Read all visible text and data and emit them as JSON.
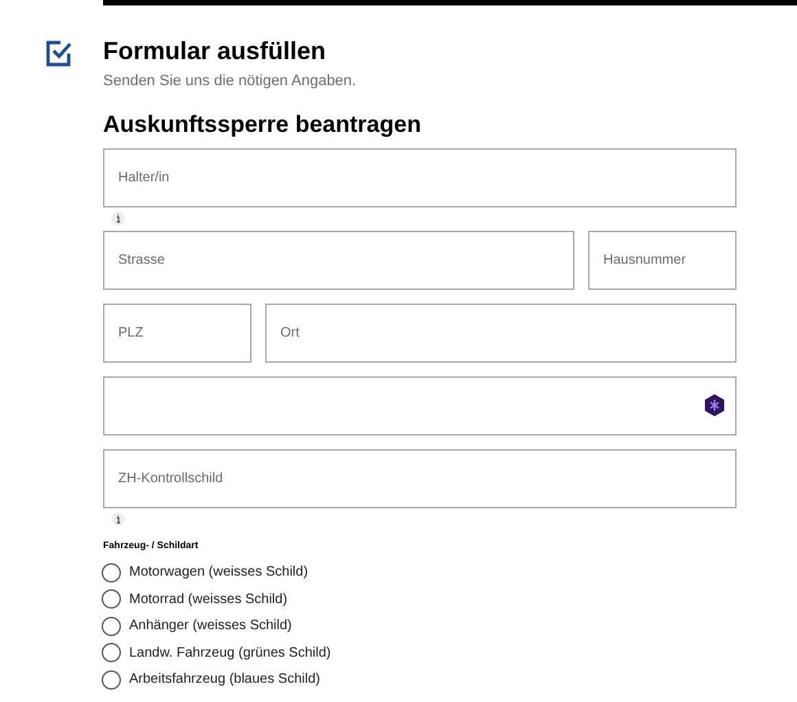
{
  "step": {
    "title": "Formular ausfüllen",
    "subtitle": "Senden Sie uns die nötigen Angaben.",
    "completed": true
  },
  "form": {
    "title": "Auskunftssperre beantragen",
    "rows": [
      {
        "info": true,
        "fields": [
          {
            "kind": "text",
            "placeholder": "Halter/in"
          }
        ]
      },
      {
        "info": false,
        "fields": [
          {
            "kind": "text",
            "placeholder": "Strasse"
          },
          {
            "kind": "short",
            "placeholder": "Hausnummer"
          }
        ]
      },
      {
        "info": false,
        "fields": [
          {
            "kind": "short",
            "placeholder": "PLZ"
          },
          {
            "kind": "text",
            "placeholder": "Ort"
          }
        ]
      },
      {
        "info": false,
        "fields": [
          {
            "kind": "extension"
          }
        ]
      },
      {
        "info": true,
        "fields": [
          {
            "kind": "text",
            "placeholder": "ZH-Kontrollschild"
          }
        ]
      }
    ],
    "radio_group": {
      "label": "Fahrzeug- / Schildart",
      "options": [
        {
          "label": "Motorwagen (weisses Schild)",
          "selected": false
        },
        {
          "label": "Motorrad (weisses Schild)",
          "selected": false
        },
        {
          "label": "Anhänger (weisses Schild)",
          "selected": false
        },
        {
          "label": "Landw. Fahrzeug (grünes Schild)",
          "selected": false
        },
        {
          "label": "Arbeitsfahrzeug (blaues Schild)",
          "selected": false
        }
      ]
    }
  }
}
